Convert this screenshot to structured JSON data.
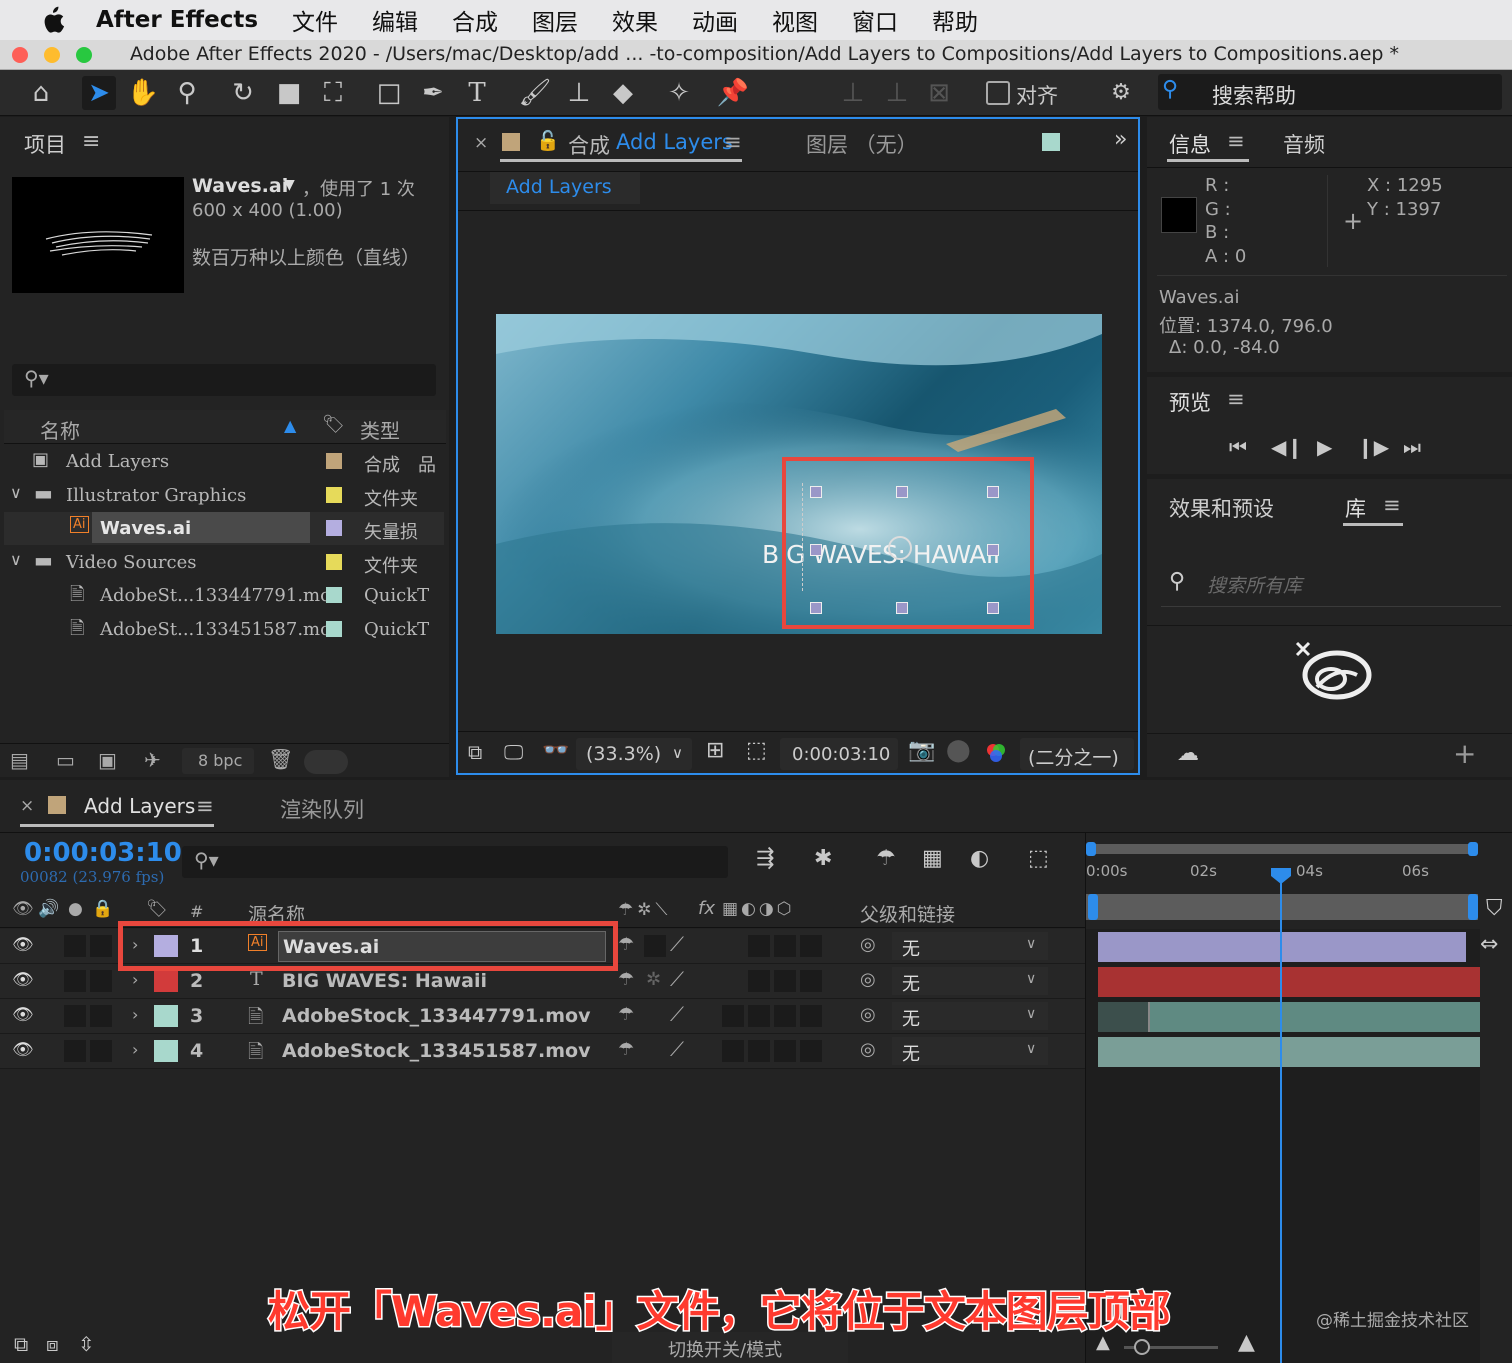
{
  "menu": {
    "app_name": "After Effects",
    "items": [
      "文件",
      "编辑",
      "合成",
      "图层",
      "效果",
      "动画",
      "视图",
      "窗口",
      "帮助"
    ]
  },
  "window": {
    "title": "Adobe After Effects 2020 - /Users/mac/Desktop/add ... -to-composition/Add Layers to Compositions/Add Layers to Compositions.aep *"
  },
  "toolbar": {
    "align_label": "对齐",
    "search_help": "搜索帮助"
  },
  "project": {
    "title": "项目",
    "file_name": "Waves.ai",
    "usage": "，使用了 1 次",
    "dimensions": "600 x 400 (1.00)",
    "color_info": "数百万种以上颜色（直线）",
    "col_name": "名称",
    "col_type": "类型",
    "items": [
      {
        "name": "Add Layers",
        "type": "合成",
        "color": "#c0a47a"
      },
      {
        "name": "Illustrator Graphics",
        "type": "文件夹",
        "color": "#e6da5a"
      },
      {
        "name": "Waves.ai",
        "type": "矢量损",
        "color": "#b4aee0"
      },
      {
        "name": "Video Sources",
        "type": "文件夹",
        "color": "#e6da5a"
      },
      {
        "name": "AdobeSt...133447791.mov",
        "type": "QuickT",
        "color": "#a8d8cc"
      },
      {
        "name": "AdobeSt...133451587.mov",
        "type": "QuickT",
        "color": "#a8d8cc"
      }
    ],
    "bpc": "8 bpc"
  },
  "composition": {
    "tab_label": "合成",
    "comp_name": "Add Layers",
    "layer_tab": "图层 （无）",
    "breadcrumb": "Add Layers",
    "overlay_text": "B G WAVES: HAWAII",
    "zoom": "(33.3%)",
    "timecode": "0:00:03:10",
    "resolution": "(二分之一)"
  },
  "info": {
    "tab_info": "信息",
    "tab_audio": "音频",
    "r_label": "R :",
    "g_label": "G :",
    "b_label": "B :",
    "a_label": "A :  0",
    "x_label": "X : 1295",
    "y_label": "Y :  1397",
    "layer_name": "Waves.ai",
    "position": "位置: 1374.0, 796.0",
    "delta": "Δ: 0.0, -84.0"
  },
  "preview": {
    "title": "预览"
  },
  "effects": {
    "tab_effects": "效果和预设",
    "tab_library": "库",
    "search_placeholder": "搜索所有库"
  },
  "timeline": {
    "tab_label": "Add Layers",
    "render_queue": "渲染队列",
    "timecode": "0:00:03:10",
    "frames": "00082 (23.976 fps)",
    "col_num": "#",
    "col_source": "源名称",
    "col_parent": "父级和链接",
    "ruler": [
      "0:00s",
      "02s",
      "04s",
      "06s"
    ],
    "layers": [
      {
        "num": "1",
        "name": "Waves.ai",
        "parent": "无",
        "color": "#b4aee0",
        "bar": "#9a97c8"
      },
      {
        "num": "2",
        "name": "BIG WAVES: Hawaii",
        "parent": "无",
        "color": "#d23b3b",
        "bar": "#a83232"
      },
      {
        "num": "3",
        "name": "AdobeStock_133447791.mov",
        "parent": "无",
        "color": "#a8d8cc",
        "bar": "#5f8a82"
      },
      {
        "num": "4",
        "name": "AdobeStock_133451587.mov",
        "parent": "无",
        "color": "#a8d8cc",
        "bar": "#7a9e97"
      }
    ],
    "bottom_label": "切换开关/模式"
  },
  "caption": "松开「Waves.ai」文件，它将位于文本图层顶部",
  "watermark": "@稀土掘金技术社区"
}
